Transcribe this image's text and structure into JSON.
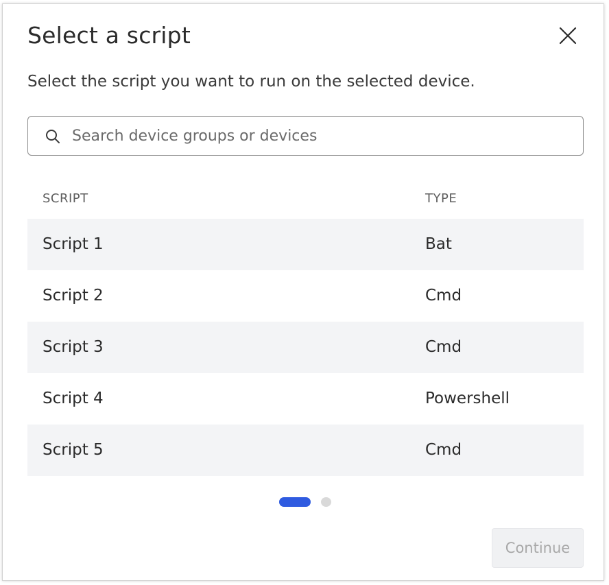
{
  "dialog": {
    "title": "Select a script",
    "subtitle": "Select the script you want to run on the selected device.",
    "close_icon": "close-icon"
  },
  "search": {
    "placeholder": "Search device groups or devices",
    "value": "",
    "icon": "search-icon"
  },
  "table": {
    "columns": [
      "SCRIPT",
      "TYPE"
    ],
    "rows": [
      {
        "script": "Script 1",
        "type": "Bat"
      },
      {
        "script": "Script 2",
        "type": "Cmd"
      },
      {
        "script": "Script 3",
        "type": "Cmd"
      },
      {
        "script": "Script 4",
        "type": "Powershell"
      },
      {
        "script": "Script 5",
        "type": "Cmd"
      }
    ]
  },
  "pagination": {
    "pages": 2,
    "current_page": 1
  },
  "footer": {
    "continue_label": "Continue",
    "continue_enabled": false
  },
  "colors": {
    "accent": "#2f5be0",
    "row_alt": "#f3f4f6",
    "disabled_button_bg": "#f0f1f3",
    "disabled_button_text": "#a8a8a8"
  }
}
